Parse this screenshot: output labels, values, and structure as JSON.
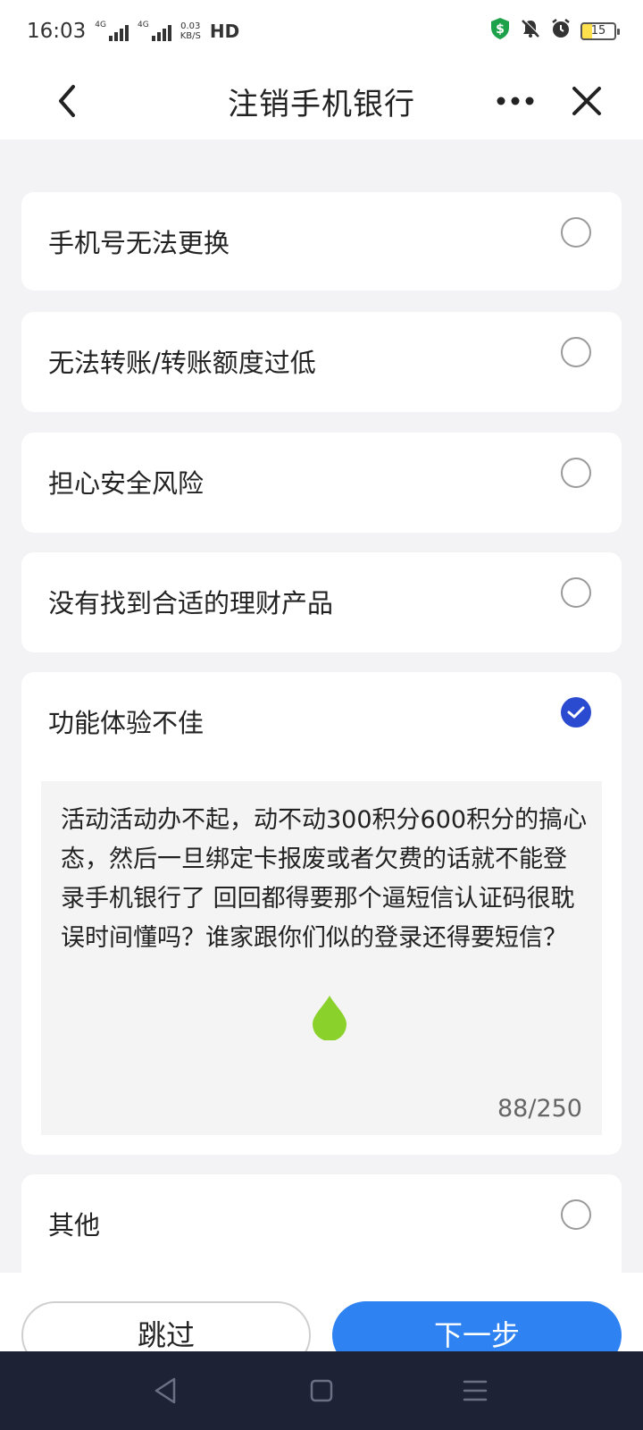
{
  "status_bar": {
    "time": "16:03",
    "signal1_label": "4G",
    "signal2_label": "4G",
    "speed_value": "0.03",
    "speed_unit": "KB/S",
    "hd": "HD",
    "battery": "15"
  },
  "nav": {
    "title": "注销手机银行"
  },
  "options": [
    {
      "label": "手机号无法更换",
      "checked": false
    },
    {
      "label": "无法转账/转账额度过低",
      "checked": false
    },
    {
      "label": "担心安全风险",
      "checked": false
    },
    {
      "label": "没有找到合适的理财产品",
      "checked": false
    },
    {
      "label": "功能体验不佳",
      "checked": true
    },
    {
      "label": "其他",
      "checked": false
    }
  ],
  "feedback": {
    "text": "活动活动办不起，动不动300积分600积分的搞心态，然后一旦绑定卡报废或者欠费的话就不能登录手机银行了  回回都得要那个逼短信认证码很耽误时间懂吗？谁家跟你们似的登录还得要短信？",
    "counter": "88/250"
  },
  "buttons": {
    "skip": "跳过",
    "next": "下一步"
  },
  "colors": {
    "accent": "#2e82f2",
    "checked": "#2a4bd0",
    "background": "#f3f3f5"
  }
}
